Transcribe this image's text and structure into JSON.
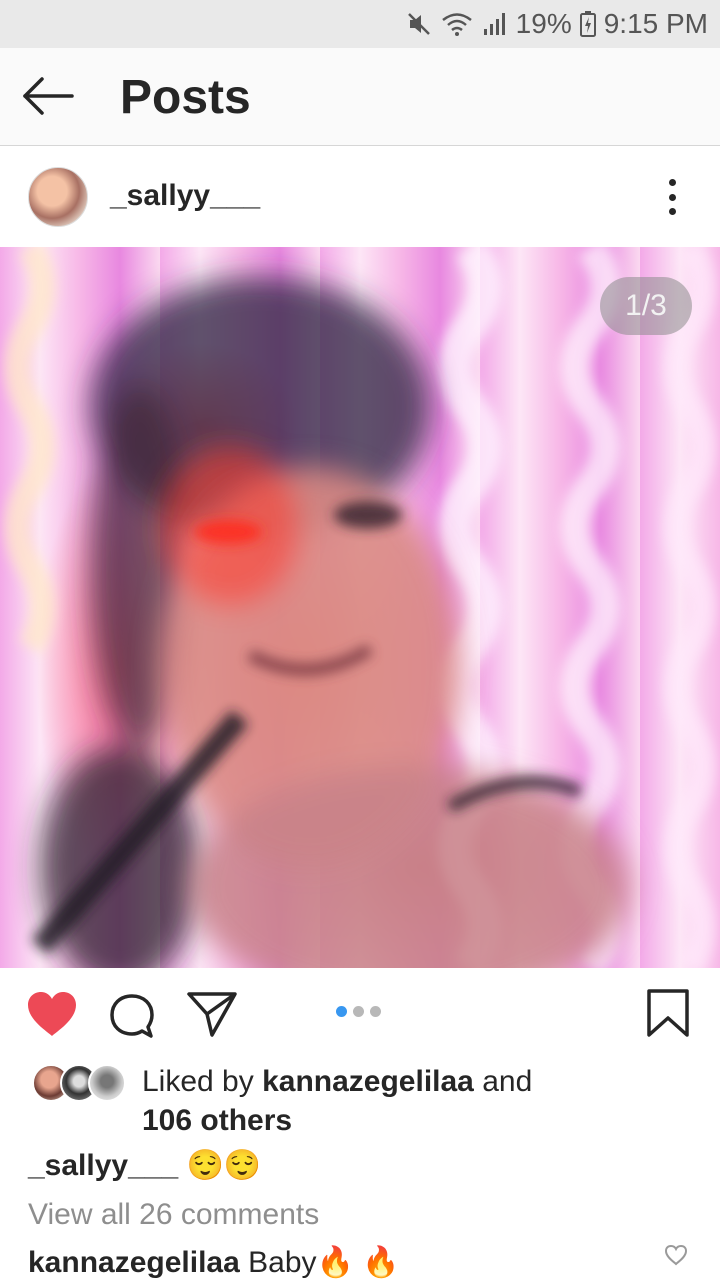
{
  "status_bar": {
    "battery": "19%",
    "time": "9:15 PM",
    "icons": [
      "mute-icon",
      "wifi-icon",
      "signal-icon",
      "battery-icon"
    ]
  },
  "header": {
    "title": "Posts",
    "back_icon": "arrow-left-icon"
  },
  "post": {
    "username": "_sallyy___",
    "image_counter": "1/3",
    "carousel": {
      "total": 3,
      "current": 1
    }
  },
  "actions": {
    "liked": true,
    "heart_color": "#ed4956",
    "icons": [
      "heart-icon",
      "comment-icon",
      "share-icon",
      "bookmark-icon"
    ]
  },
  "likes": {
    "prefix": "Liked by",
    "user": "kannazegelilaa",
    "and": "and",
    "others": "106 others"
  },
  "caption": {
    "username": "_sallyy___",
    "text": "😌😌"
  },
  "comments": {
    "view_all": "View all 26 comments",
    "first": {
      "username": "kannazegelilaa",
      "text": "Baby🔥 🔥"
    }
  },
  "colors": {
    "accent_blue": "#3897f0",
    "muted_text": "#8e8e8e"
  }
}
